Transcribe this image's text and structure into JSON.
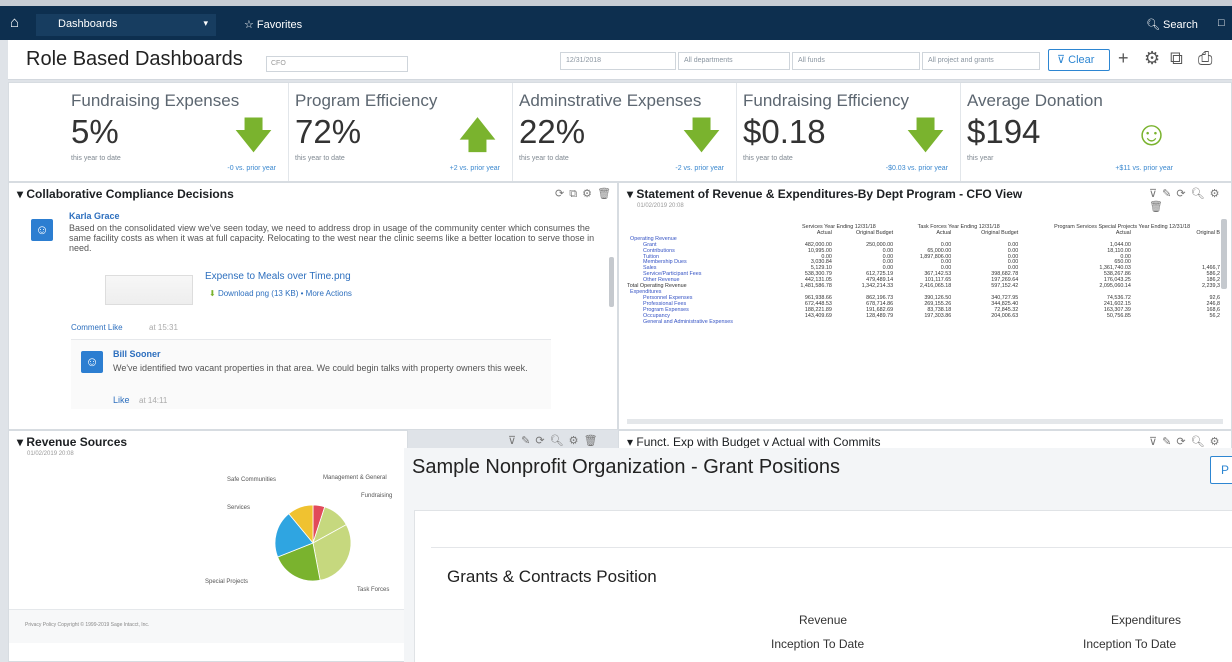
{
  "nav": {
    "home_icon": "home-icon",
    "dashboards": "Dashboards",
    "favorites": "Favorites",
    "search": "Search"
  },
  "header": {
    "title": "Role Based Dashboards",
    "role": "CFO",
    "date": "12/31/2018",
    "f1": "All departments",
    "f2": "All funds",
    "f3": "All project and grants",
    "clear": "Clear"
  },
  "kpis": [
    {
      "title": "Fundraising Expenses",
      "value": "5%",
      "period": "this year to date",
      "compare": "-0 vs. prior year",
      "trend": "down",
      "color": "#7ab32e"
    },
    {
      "title": "Program Efficiency",
      "value": "72%",
      "period": "this year to date",
      "compare": "+2 vs. prior year",
      "trend": "up",
      "color": "#7ab32e"
    },
    {
      "title": "Adminstrative Expenses",
      "value": "22%",
      "period": "this year to date",
      "compare": "-2 vs. prior year",
      "trend": "down",
      "color": "#7ab32e"
    },
    {
      "title": "Fundraising Efficiency",
      "value": "$0.18",
      "period": "this year to date",
      "compare": "-$0.03 vs. prior year",
      "trend": "down",
      "color": "#7ab32e"
    },
    {
      "title": "Average Donation",
      "value": "$194",
      "period": "this year",
      "compare": "+$11 vs. prior year",
      "trend": "smile",
      "color": "#7ab32e"
    }
  ],
  "collab": {
    "title": "Collaborative Compliance Decisions",
    "author": "Karla Grace",
    "message": "Based on the consolidated view we've seen today, we need to address drop in usage of the community center which consumes the same facility costs as when it was at full capacity. Relocating to the west near the clinic seems like a better location to serve those in need.",
    "attachment": "Expense to Meals over Time.png",
    "download": "Download png (13 KB) • More Actions",
    "actions": "Comment  Like",
    "time1": "at 15:31",
    "reply_author": "Bill Sooner",
    "reply_msg": "We've identified two vacant properties in that area. We could begin talks with property owners this week.",
    "like": "Like",
    "time2": "at 14:11"
  },
  "stmt": {
    "title": "Statement of Revenue & Expenditures-By Dept Program - CFO View",
    "subtitle": "01/02/2019 20:08",
    "col_groups": [
      "Services Year Ending 12/31/18",
      "Task Forces Year Ending 12/31/18",
      "Program Services Special Projects Year Ending 12/31/18"
    ],
    "col_heads": [
      "Actual",
      "Original Budget",
      "Actual",
      "Original Budget",
      "Actual",
      "Original B"
    ],
    "rows": [
      {
        "label": "Operating Revenue",
        "cls": "",
        "v": [
          "",
          "",
          "",
          "",
          "",
          ""
        ]
      },
      {
        "label": "Grant",
        "cls": "ind",
        "v": [
          "482,000.00",
          "250,000.00",
          "0.00",
          "0.00",
          "1,044.00",
          ""
        ]
      },
      {
        "label": "Contributions",
        "cls": "ind",
        "v": [
          "10,995.00",
          "0.00",
          "65,000.00",
          "0.00",
          "18,110.00",
          ""
        ]
      },
      {
        "label": "Tuition",
        "cls": "ind",
        "v": [
          "0.00",
          "0.00",
          "1,897,806.00",
          "0.00",
          "0.00",
          ""
        ]
      },
      {
        "label": "Membership Dues",
        "cls": "ind",
        "v": [
          "3,030.84",
          "0.00",
          "0.00",
          "0.00",
          "650.00",
          ""
        ]
      },
      {
        "label": "Sales",
        "cls": "ind",
        "v": [
          "5,129.10",
          "0.00",
          "0.00",
          "0.00",
          "1,361,740.03",
          "1,466,7"
        ]
      },
      {
        "label": "Service/Participant Fees",
        "cls": "ind",
        "v": [
          "538,300.79",
          "612,725.19",
          "367,142.53",
          "398,682.78",
          "538,267.86",
          "586,2"
        ]
      },
      {
        "label": "Other Revenue",
        "cls": "ind",
        "v": [
          "442,131.05",
          "479,489.14",
          "101,117.65",
          "197,269.64",
          "176,043.25",
          "186,2"
        ]
      },
      {
        "label": "Total Operating Revenue",
        "cls": "tot",
        "v": [
          "1,481,586.78",
          "1,342,214.33",
          "2,416,065.18",
          "597,152.42",
          "2,095,060.14",
          "2,239,3"
        ]
      },
      {
        "label": "Expenditures",
        "cls": "",
        "v": [
          "",
          "",
          "",
          "",
          "",
          ""
        ]
      },
      {
        "label": "Personnel Expenses",
        "cls": "ind",
        "v": [
          "961,938.66",
          "862,196.73",
          "390,126.50",
          "340,727.95",
          "74,536.72",
          "92,6"
        ]
      },
      {
        "label": "Professional Fees",
        "cls": "ind",
        "v": [
          "672,448.53",
          "678,714.86",
          "269,155.26",
          "344,825.40",
          "241,602.15",
          "246,8"
        ]
      },
      {
        "label": "Program Expenses",
        "cls": "ind",
        "v": [
          "188,221.89",
          "191,682.69",
          "83,738.18",
          "72,845.32",
          "163,307.39",
          "168,6"
        ]
      },
      {
        "label": "Occupancy",
        "cls": "ind",
        "v": [
          "143,409.69",
          "128,489.79",
          "197,303.86",
          "204,006.63",
          "50,756.85",
          "56,2"
        ]
      },
      {
        "label": "General and Administrative Expenses",
        "cls": "ind",
        "v": [
          "",
          "",
          "",
          "",
          "",
          ""
        ]
      }
    ]
  },
  "revenue": {
    "title": "Revenue Sources",
    "subtitle": "01/02/2019 20:08",
    "labels": [
      "Safe Communities",
      "Management & General",
      "Fundraising",
      "Services",
      "Special Projects",
      "Task Forces"
    ],
    "footer": "Privacy Policy    Copyright © 1999-2019 Sage Intacct, Inc."
  },
  "funct": {
    "title": "Funct. Exp with Budget v Actual with Commits"
  },
  "chart_data": {
    "type": "pie",
    "title": "Revenue Sources",
    "categories": [
      "Safe Communities",
      "Management & General",
      "Fundraising",
      "Task Forces",
      "Special Projects",
      "Services"
    ],
    "values": [
      5,
      12,
      30,
      22,
      20,
      11
    ],
    "colors": [
      "#e14a5a",
      "#c6d87e",
      "#c6d87e",
      "#7ab32e",
      "#2fa5e1",
      "#f0c230"
    ]
  },
  "grant": {
    "title": "Sample Nonprofit Organization - Grant Positions",
    "button": "P",
    "card_title": "Grants & Contracts Position",
    "rev": "Revenue",
    "exp": "Expenditures",
    "itd1": "Inception To Date",
    "itd2": "Inception To Date"
  }
}
